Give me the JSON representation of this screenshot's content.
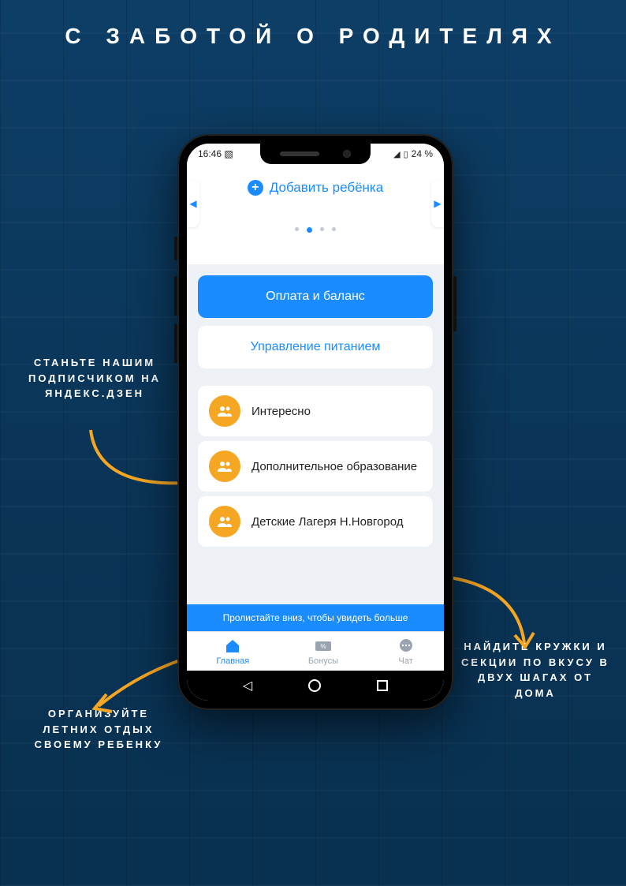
{
  "title": "С ЗАБОТОЙ О РОДИТЕЛЯХ",
  "statusbar": {
    "time": "16:46",
    "battery": "24 %"
  },
  "add_child": "Добавить ребёнка",
  "btn": {
    "primary": "Оплата и баланс",
    "secondary": "Управление питанием"
  },
  "menu": [
    {
      "label": "Интересно"
    },
    {
      "label": "Дополнительное образование"
    },
    {
      "label": "Детские Лагеря Н.Новгород"
    }
  ],
  "hint": "Пролистайте вниз, чтобы увидеть больше",
  "nav": {
    "home": "Главная",
    "bonus": "Бонусы",
    "chat": "Чат"
  },
  "callouts": {
    "c1": "СТАНЬТЕ НАШИМ ПОДПИСЧИКОМ НА ЯНДЕКС.ДЗЕН",
    "c2": "ОРГАНИЗУЙТЕ ЛЕТНИХ ОТДЫХ СВОЕМУ РЕБЕНКУ",
    "c3": "НАЙДИТЕ КРУЖКИ И СЕКЦИИ ПО ВКУСУ В ДВУХ ШАГАХ ОТ ДОМА"
  }
}
